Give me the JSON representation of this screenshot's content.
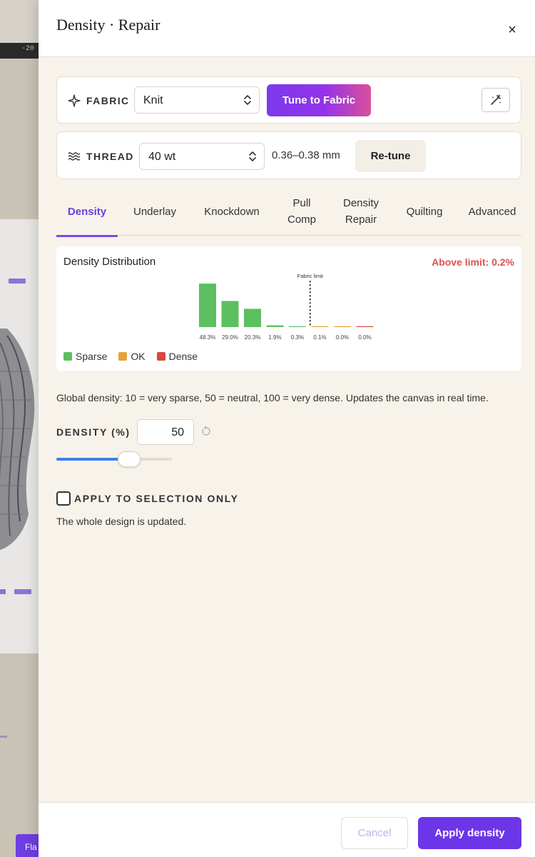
{
  "canvas": {
    "ruler_label": "-20",
    "bottom_button_label": "Fla"
  },
  "drawer": {
    "title": "Density · Repair",
    "close_glyph": "×"
  },
  "fabric": {
    "label": "FABRIC",
    "icon": "sparkle-icon",
    "selected": "Knit",
    "tune_button": "Tune to Fabric",
    "wand_icon": "magic-wand-icon"
  },
  "thread": {
    "label": "THREAD",
    "icon": "waves-icon",
    "selected": "40 wt",
    "range": "0.36–0.38 mm",
    "retune_button": "Re-tune"
  },
  "tabs": [
    {
      "label": "Density",
      "active": true
    },
    {
      "label": "Underlay",
      "active": false
    },
    {
      "label": "Knockdown",
      "active": false
    },
    {
      "label": "Pull Comp",
      "active": false
    },
    {
      "label": "Density Repair",
      "active": false
    },
    {
      "label": "Quilting",
      "active": false
    },
    {
      "label": "Advanced",
      "active": false
    }
  ],
  "distribution": {
    "title": "Density Distribution",
    "above_limit": "Above limit: 0.2%",
    "legend": [
      {
        "label": "Sparse",
        "color": "#5cbf60"
      },
      {
        "label": "OK",
        "color": "#e8a23a"
      },
      {
        "label": "Dense",
        "color": "#d9473f"
      }
    ]
  },
  "chart_data": {
    "type": "bar",
    "categories": [
      "48.3%",
      "29.0%",
      "20.3%",
      "1.9%",
      "0.3%",
      "0.1%",
      "0.0%",
      "0.0%"
    ],
    "values": [
      48.3,
      29.0,
      20.3,
      1.9,
      0.3,
      0.1,
      0.0,
      0.0
    ],
    "bar_classes": [
      "Sparse",
      "Sparse",
      "Sparse",
      "Sparse",
      "Sparse",
      "OK",
      "OK",
      "Dense"
    ],
    "ylim": [
      0,
      50
    ],
    "annotation": "Fabric limit",
    "limit_after_index": 5,
    "grid": false
  },
  "density": {
    "description": "Global density: 10 = very sparse, 50 = neutral, 100 = very dense. Updates the canvas in real time.",
    "label": "DENSITY (%)",
    "value": "50",
    "slider_min": 10,
    "slider_max": 100,
    "slider_value": 50,
    "reset_icon": "reset-icon"
  },
  "selection": {
    "label": "APPLY TO SELECTION ONLY",
    "checked": false,
    "help": "The whole design is updated."
  },
  "footer": {
    "cancel": "Cancel",
    "apply": "Apply density"
  },
  "colors": {
    "accent": "#6d35e8",
    "danger": "#d9534f",
    "background": "#f7f3eb"
  }
}
